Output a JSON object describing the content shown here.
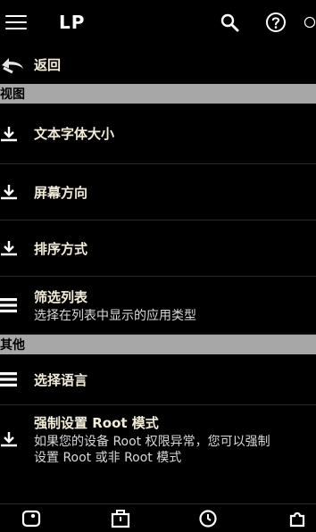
{
  "appbar": {
    "title": "LP",
    "icons": [
      "menu-icon",
      "search-icon",
      "help-icon",
      "more-icon"
    ]
  },
  "back": {
    "label": "返回",
    "icon": "back-icon"
  },
  "sections": {
    "view": "视图",
    "other": "其他"
  },
  "items": {
    "font_size": {
      "label": "文本字体大小",
      "icon": "download-icon"
    },
    "orientation": {
      "label": "屏幕方向",
      "icon": "download-icon"
    },
    "sort": {
      "label": "排序方式",
      "icon": "download-icon"
    },
    "filter": {
      "label": "筛选列表",
      "sub": "选择在列表中显示的应用类型",
      "icon": "list-icon"
    },
    "language": {
      "label": "选择语言",
      "icon": "list-icon"
    },
    "root": {
      "label": "强制设置 Root 模式",
      "sub1": "如果您的设备 Root 权限异常，您可以强制",
      "sub2": "设置 Root 或非 Root 模式",
      "icon": "download-icon"
    }
  },
  "bottom_nav": [
    "apps-icon",
    "toolbox-icon",
    "backup-icon",
    "extensions-icon"
  ],
  "colors": {
    "background": "#000000",
    "section": "#a7a7a7",
    "label": "#f3ecd8"
  }
}
